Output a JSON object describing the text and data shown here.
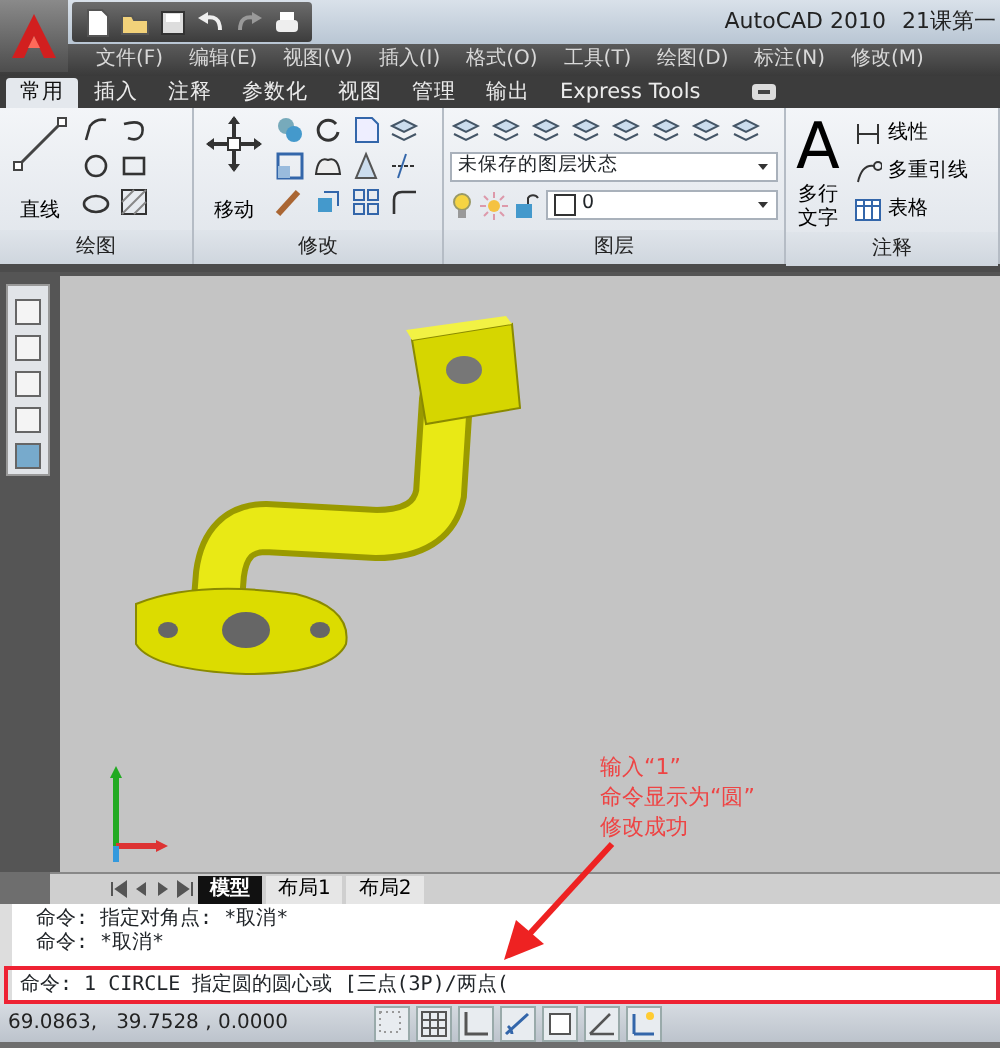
{
  "title_bar": {
    "app_name": "AutoCAD 2010",
    "document_title": "21课第一"
  },
  "menu_bar": [
    "文件(F)",
    "编辑(E)",
    "视图(V)",
    "插入(I)",
    "格式(O)",
    "工具(T)",
    "绘图(D)",
    "标注(N)",
    "修改(M)"
  ],
  "ribbon_tabs": [
    {
      "label": "常用",
      "selected": true
    },
    {
      "label": "插入",
      "selected": false
    },
    {
      "label": "注释",
      "selected": false
    },
    {
      "label": "参数化",
      "selected": false
    },
    {
      "label": "视图",
      "selected": false
    },
    {
      "label": "管理",
      "selected": false
    },
    {
      "label": "输出",
      "selected": false
    },
    {
      "label": "Express Tools",
      "selected": false
    }
  ],
  "ribbon_panels": [
    {
      "kind": "draw",
      "title": "绘图",
      "large_tool": "直线"
    },
    {
      "kind": "modify",
      "title": "修改",
      "large_tool": "移动"
    },
    {
      "kind": "layers",
      "title": "图层",
      "layer_state": "未保存的图层状态",
      "current_layer": "0"
    },
    {
      "kind": "annotation",
      "title": "注释",
      "text_icon": "A",
      "large_tool": "多行文字",
      "tools": [
        "线性",
        "多重引线",
        "表格"
      ]
    }
  ],
  "viewport": {
    "annotation": [
      "输入“1”",
      "命令显示为“圆”",
      "修改成功"
    ]
  },
  "layout_tabs": [
    {
      "label": "模型",
      "selected": true
    },
    {
      "label": "布局1",
      "selected": false
    },
    {
      "label": "布局2",
      "selected": false
    }
  ],
  "command_history": [
    "命令: 指定对角点: *取消*",
    "命令: *取消*"
  ],
  "command_prompt": "命令: 1 CIRCLE 指定圆的圆心或 [三点(3P)/两点(",
  "status_bar": {
    "coordinates": "69.0863,   39.7528 , 0.0000"
  }
}
